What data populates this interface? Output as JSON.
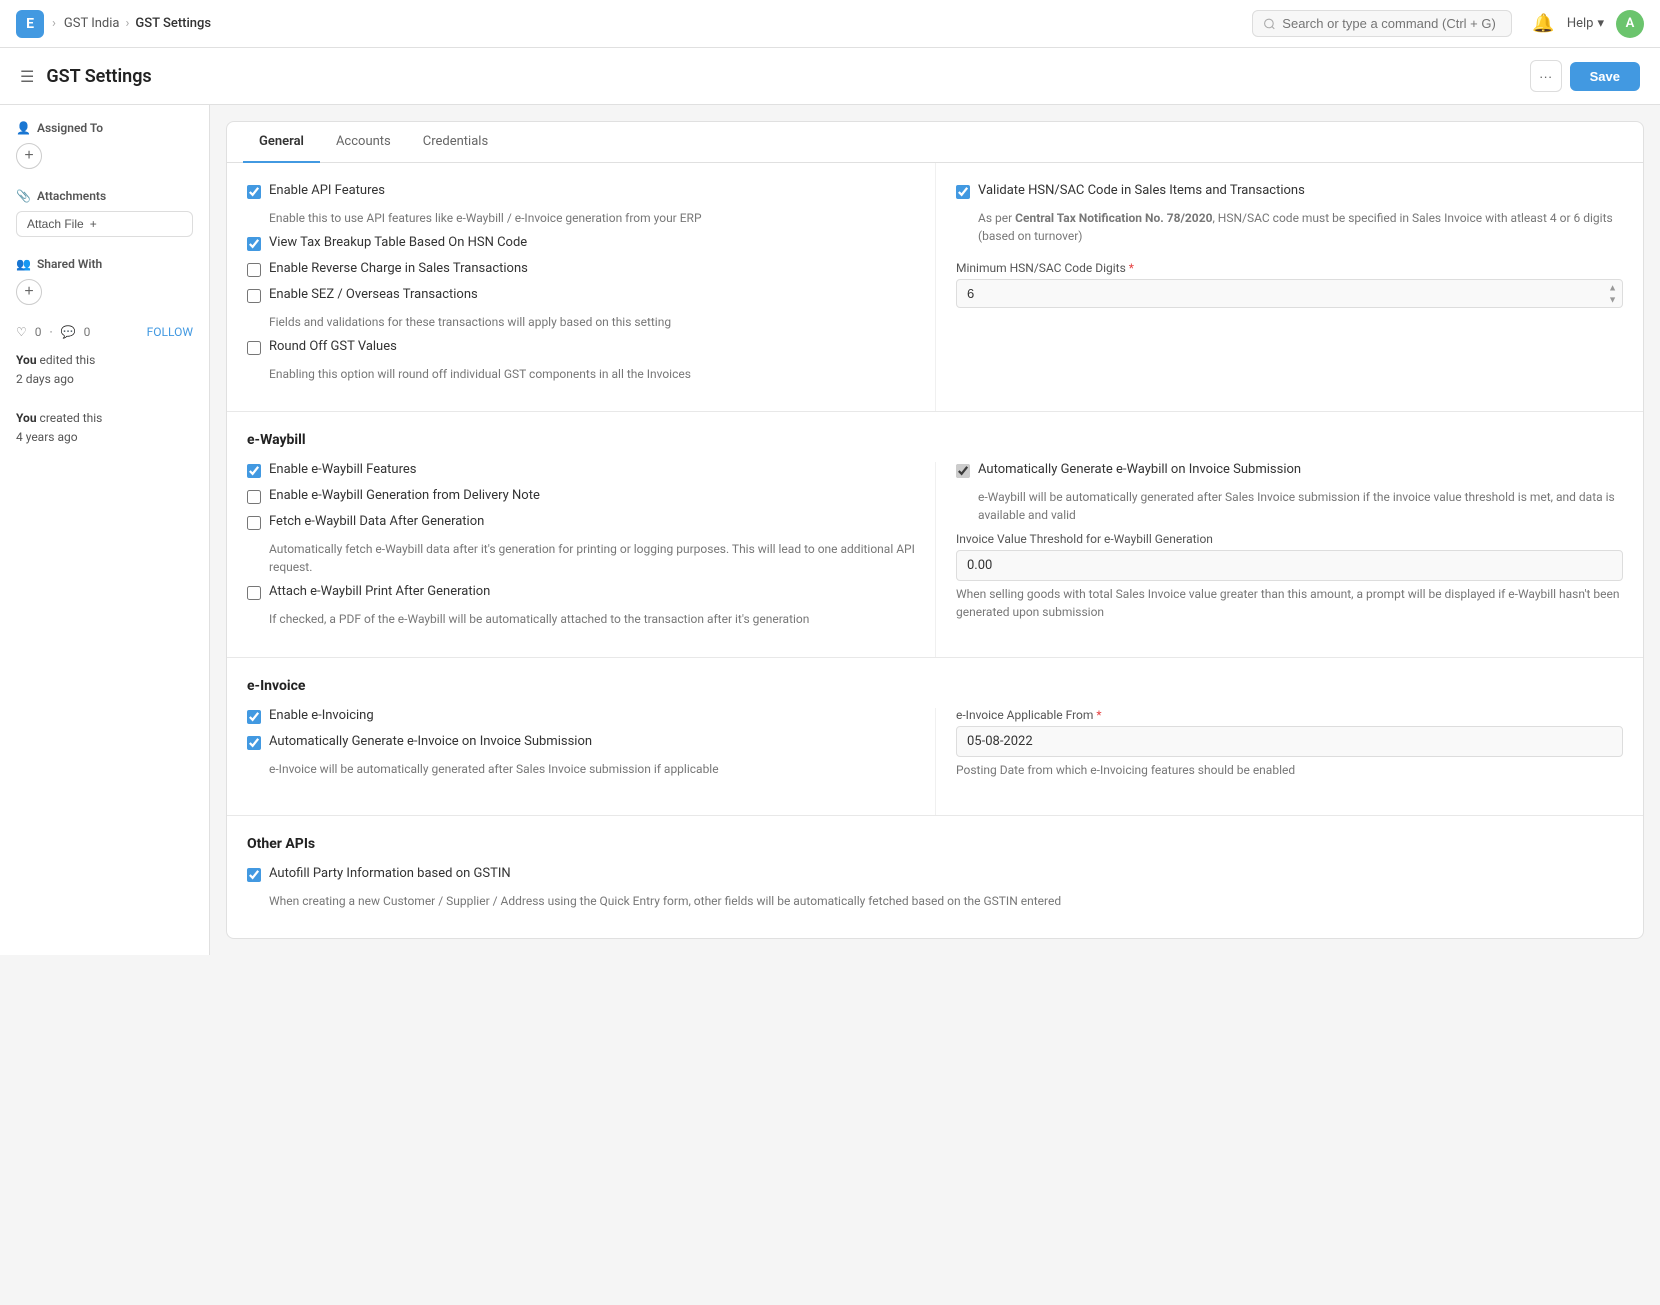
{
  "topnav": {
    "app_letter": "E",
    "breadcrumbs": [
      "GST India",
      "GST Settings"
    ],
    "search_placeholder": "Search or type a command (Ctrl + G)",
    "help_label": "Help",
    "user_initial": "A"
  },
  "header": {
    "title": "GST Settings",
    "more_label": "···",
    "save_label": "Save"
  },
  "sidebar": {
    "assigned_to_label": "Assigned To",
    "attachments_label": "Attachments",
    "attach_file_label": "Attach File",
    "shared_with_label": "Shared With",
    "likes_count": "0",
    "comments_count": "0",
    "follow_label": "FOLLOW",
    "activity_1": "You edited this",
    "activity_1_time": "2 days ago",
    "activity_2": "You created this",
    "activity_2_time": "4 years ago"
  },
  "tabs": [
    {
      "label": "General",
      "active": true
    },
    {
      "label": "Accounts",
      "active": false
    },
    {
      "label": "Credentials",
      "active": false
    }
  ],
  "general": {
    "left": {
      "api_features_label": "Enable API Features",
      "api_features_desc": "Enable this to use API features like e-Waybill / e-Invoice generation from your ERP",
      "tax_breakup_label": "View Tax Breakup Table Based On HSN Code",
      "reverse_charge_label": "Enable Reverse Charge in Sales Transactions",
      "sez_label": "Enable SEZ / Overseas Transactions",
      "sez_desc": "Fields and validations for these transactions will apply based on this setting",
      "round_off_label": "Round Off GST Values",
      "round_off_desc": "Enabling this option will round off individual GST components in all the Invoices"
    },
    "right": {
      "validate_hsn_label": "Validate HSN/SAC Code in Sales Items and Transactions",
      "validate_hsn_desc_part1": "As per ",
      "validate_hsn_desc_bold": "Central Tax Notification No. 78/2020",
      "validate_hsn_desc_part2": ", HSN/SAC code must be specified in Sales Invoice with atleast 4 or 6 digits (based on turnover)",
      "min_hsn_label": "Minimum HSN/SAC Code Digits",
      "min_hsn_required": "*",
      "min_hsn_value": "6"
    }
  },
  "ewaybill": {
    "section_title": "e-Waybill",
    "left": {
      "enable_label": "Enable e-Waybill Features",
      "generation_note_label": "Enable e-Waybill Generation from Delivery Note",
      "fetch_label": "Fetch e-Waybill Data After Generation",
      "fetch_desc": "Automatically fetch e-Waybill data after it's generation for printing or logging purposes. This will lead to one additional API request.",
      "attach_label": "Attach e-Waybill Print After Generation",
      "attach_desc": "If checked, a PDF of the e-Waybill will be automatically attached to the transaction after it's generation"
    },
    "right": {
      "auto_generate_label": "Automatically Generate e-Waybill on Invoice Submission",
      "auto_generate_desc": "e-Waybill will be automatically generated after Sales Invoice submission if the invoice value threshold is met, and data is available and valid",
      "threshold_label": "Invoice Value Threshold for e-Waybill Generation",
      "threshold_value": "0.00",
      "threshold_desc": "When selling goods with total Sales Invoice value greater than this amount, a prompt will be displayed if e-Waybill hasn't been generated upon submission"
    }
  },
  "einvoice": {
    "section_title": "e-Invoice",
    "left": {
      "enable_label": "Enable e-Invoicing",
      "auto_generate_label": "Automatically Generate e-Invoice on Invoice Submission",
      "auto_generate_desc": "e-Invoice will be automatically generated after Sales Invoice submission if applicable"
    },
    "right": {
      "applicable_from_label": "e-Invoice Applicable From",
      "applicable_from_required": "*",
      "applicable_from_value": "05-08-2022",
      "applicable_from_desc": "Posting Date from which e-Invoicing features should be enabled"
    }
  },
  "other_apis": {
    "section_title": "Other APIs",
    "autofill_label": "Autofill Party Information based on GSTIN",
    "autofill_desc": "When creating a new Customer / Supplier / Address using the Quick Entry form, other fields will be automatically fetched based on the GSTIN entered"
  }
}
